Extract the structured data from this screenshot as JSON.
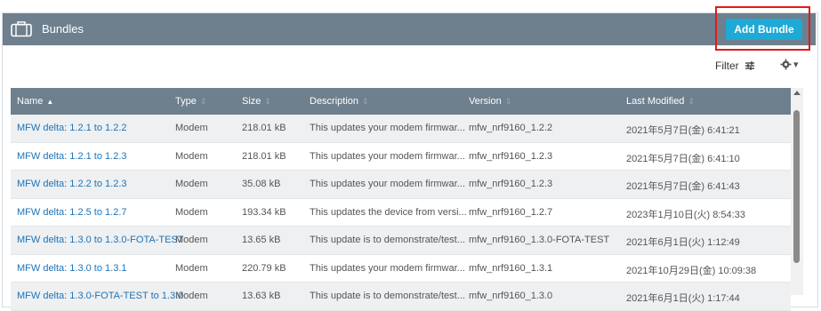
{
  "panel": {
    "title": "Bundles",
    "icon": "briefcase-icon"
  },
  "actions": {
    "add_bundle": "Add Bundle",
    "filter": "Filter"
  },
  "table": {
    "headers": {
      "name": "Name",
      "type": "Type",
      "size": "Size",
      "description": "Description",
      "version": "Version",
      "last_modified": "Last Modified"
    },
    "rows": [
      {
        "name": "MFW delta: 1.2.1 to 1.2.2",
        "type": "Modem",
        "size": "218.01 kB",
        "description": "This updates your modem firmwar...",
        "version": "mfw_nrf9160_1.2.2",
        "last_modified": "2021年5月7日(金) 6:41:21"
      },
      {
        "name": "MFW delta: 1.2.1 to 1.2.3",
        "type": "Modem",
        "size": "218.01 kB",
        "description": "This updates your modem firmwar...",
        "version": "mfw_nrf9160_1.2.3",
        "last_modified": "2021年5月7日(金) 6:41:10"
      },
      {
        "name": "MFW delta: 1.2.2 to 1.2.3",
        "type": "Modem",
        "size": "35.08 kB",
        "description": "This updates your modem firmwar...",
        "version": "mfw_nrf9160_1.2.3",
        "last_modified": "2021年5月7日(金) 6:41:43"
      },
      {
        "name": "MFW delta: 1.2.5 to 1.2.7",
        "type": "Modem",
        "size": "193.34 kB",
        "description": "This updates the device from versi...",
        "version": "mfw_nrf9160_1.2.7",
        "last_modified": "2023年1月10日(火) 8:54:33"
      },
      {
        "name": "MFW delta: 1.3.0 to 1.3.0-FOTA-TEST",
        "type": "Modem",
        "size": "13.65 kB",
        "description": "This update is to demonstrate/test...",
        "version": "mfw_nrf9160_1.3.0-FOTA-TEST",
        "last_modified": "2021年6月1日(火) 1:12:49"
      },
      {
        "name": "MFW delta: 1.3.0 to 1.3.1",
        "type": "Modem",
        "size": "220.79 kB",
        "description": "This updates your modem firmwar...",
        "version": "mfw_nrf9160_1.3.1",
        "last_modified": "2021年10月29日(金) 10:09:38"
      },
      {
        "name": "MFW delta: 1.3.0-FOTA-TEST to 1.3.0",
        "type": "Modem",
        "size": "13.63 kB",
        "description": "This update is to demonstrate/test...",
        "version": "mfw_nrf9160_1.3.0",
        "last_modified": "2021年6月1日(火) 1:17:44"
      }
    ]
  }
}
